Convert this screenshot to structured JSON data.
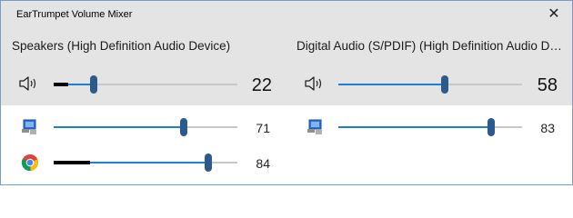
{
  "window": {
    "title": "EarTrumpet Volume Mixer",
    "close_glyph": "✕"
  },
  "colors": {
    "accent": "#1e7fd8",
    "thumb": "#2d5a8c",
    "track": "#c8c8c8",
    "peak": "#000000",
    "header_bg": "#e4e4e4",
    "border": "#7a9cc9"
  },
  "devices": [
    {
      "name": "Speakers (High Definition Audio Device)",
      "icon": "speaker-icon",
      "volume": 22,
      "volume_label": "22",
      "peak_level": 0.08,
      "apps": [
        {
          "name": "system-sounds",
          "icon": "system-sounds-icon",
          "volume": 71,
          "volume_label": "71",
          "peak_level": 0
        },
        {
          "name": "chrome",
          "icon": "chrome-icon",
          "volume": 84,
          "volume_label": "84",
          "peak_level": 0.2
        }
      ]
    },
    {
      "name": "Digital Audio (S/PDIF) (High Definition Audio De...",
      "icon": "speaker-icon",
      "volume": 58,
      "volume_label": "58",
      "peak_level": 0,
      "apps": [
        {
          "name": "system-sounds",
          "icon": "system-sounds-icon",
          "volume": 83,
          "volume_label": "83",
          "peak_level": 0
        }
      ]
    }
  ]
}
